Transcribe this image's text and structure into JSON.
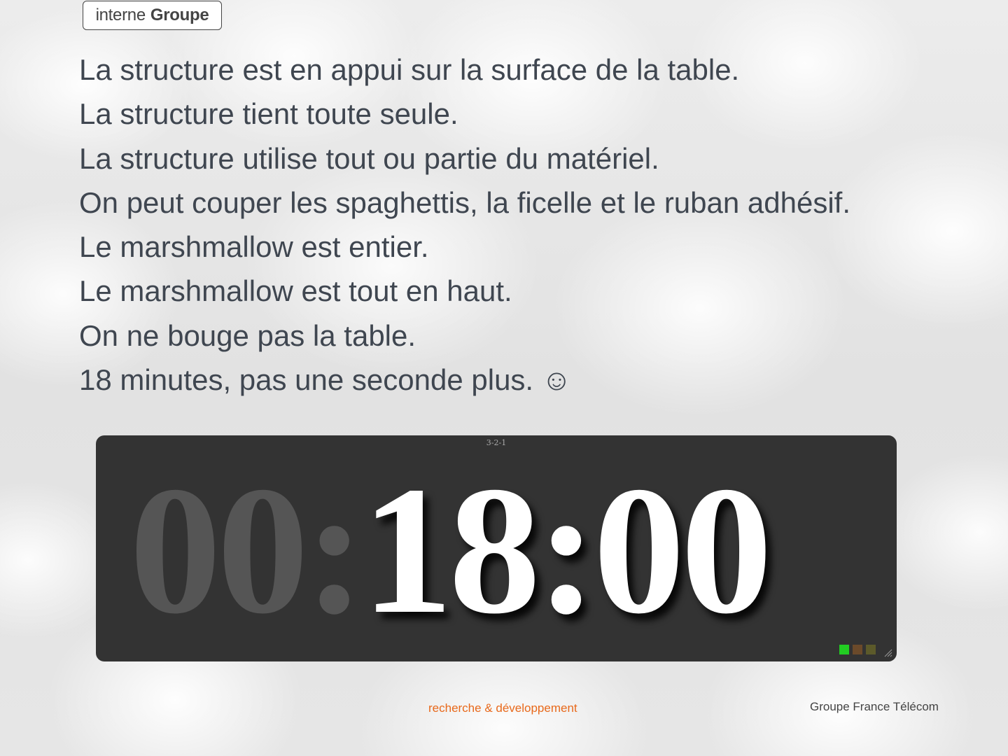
{
  "badge": {
    "light": "interne",
    "bold": "Groupe"
  },
  "rules": [
    "La structure est en appui sur la surface de la table.",
    "La structure tient toute seule.",
    "La structure utilise tout ou partie du matériel.",
    "On peut couper les spaghettis, la ficelle et le ruban adhésif.",
    "Le marshmallow est entier.",
    "Le marshmallow est tout en haut.",
    "On ne bouge pas la table.",
    "18 minutes, pas une seconde plus. ☺"
  ],
  "timer": {
    "title": "3-2-1",
    "hours": "00",
    "sep1": ":",
    "minutes_seconds": "18:00",
    "indicators": [
      "#22cc22",
      "#6b4a2a",
      "#5c5a2a"
    ]
  },
  "footer": {
    "center": "recherche & développement",
    "right": "Groupe France Télécom"
  },
  "colors": {
    "text": "#3f4650",
    "accent_orange": "#e8691b",
    "timer_bg": "#333333"
  }
}
